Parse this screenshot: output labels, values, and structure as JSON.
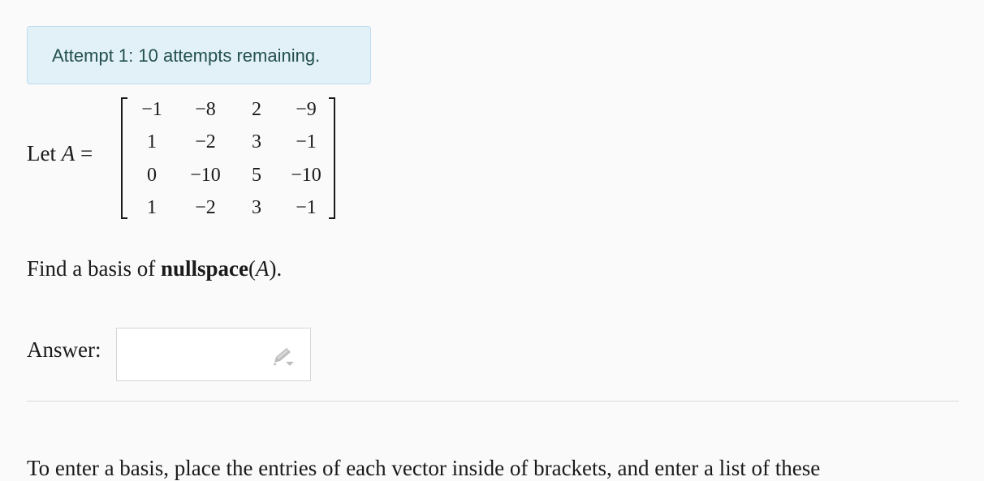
{
  "attempt": {
    "text": "Attempt 1: 10 attempts remaining."
  },
  "problem": {
    "let_prefix": "Let ",
    "matrix_var": "A",
    "equals": " =",
    "matrix": [
      [
        "−1",
        "−8",
        "2",
        "−9"
      ],
      [
        "1",
        "−2",
        "3",
        "−1"
      ],
      [
        "0",
        "−10",
        "5",
        "−10"
      ],
      [
        "1",
        "−2",
        "3",
        "−1"
      ]
    ],
    "find_prefix": "Find a basis of ",
    "find_operator": "nullspace",
    "find_open": "(",
    "find_var": "A",
    "find_close": ")."
  },
  "answer": {
    "label": "Answer:",
    "value": ""
  },
  "instructions": {
    "text": "To enter a basis, place the entries of each vector inside of brackets, and enter a list of these"
  },
  "icons": {
    "edit": "pencil-icon"
  }
}
